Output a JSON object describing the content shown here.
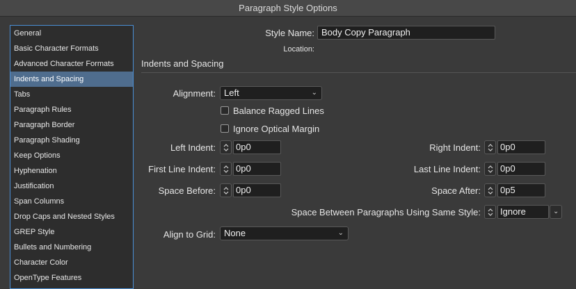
{
  "window": {
    "title": "Paragraph Style Options"
  },
  "sidebar": {
    "items": [
      "General",
      "Basic Character Formats",
      "Advanced Character Formats",
      "Indents and Spacing",
      "Tabs",
      "Paragraph Rules",
      "Paragraph Border",
      "Paragraph Shading",
      "Keep Options",
      "Hyphenation",
      "Justification",
      "Span Columns",
      "Drop Caps and Nested Styles",
      "GREP Style",
      "Bullets and Numbering",
      "Character Color",
      "OpenType Features"
    ],
    "selected_index": 3
  },
  "style": {
    "name_label": "Style Name:",
    "name_value": "Body Copy Paragraph",
    "location_label": "Location:"
  },
  "section": {
    "title": "Indents and Spacing"
  },
  "alignment": {
    "label": "Alignment:",
    "value": "Left"
  },
  "checkboxes": {
    "balance_label": "Balance Ragged Lines",
    "balance_checked": false,
    "optical_label": "Ignore Optical Margin",
    "optical_checked": false
  },
  "fields": {
    "left_indent": {
      "label": "Left Indent:",
      "value": "0p0"
    },
    "right_indent": {
      "label": "Right Indent:",
      "value": "0p0"
    },
    "first_line_indent": {
      "label": "First Line Indent:",
      "value": "0p0"
    },
    "last_line_indent": {
      "label": "Last Line Indent:",
      "value": "0p0"
    },
    "space_before": {
      "label": "Space Before:",
      "value": "0p0"
    },
    "space_after": {
      "label": "Space After:",
      "value": "0p5"
    }
  },
  "space_between": {
    "label": "Space Between Paragraphs Using Same Style:",
    "value": "Ignore"
  },
  "align_to_grid": {
    "label": "Align to Grid:",
    "value": "None"
  },
  "colors": {
    "selection": "#4f6d8e",
    "focus_border": "#4a8fd6",
    "background": "#3a3a3a"
  }
}
